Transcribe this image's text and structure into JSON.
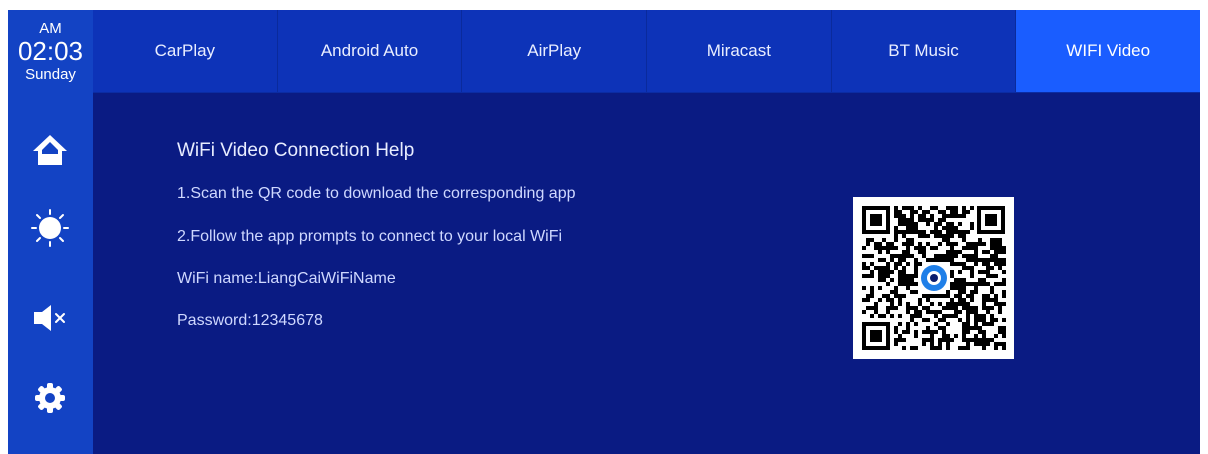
{
  "clock": {
    "ampm": "AM",
    "time": "02:03",
    "day": "Sunday"
  },
  "sidebar": {
    "buttons": [
      {
        "name": "home-icon"
      },
      {
        "name": "brightness-icon"
      },
      {
        "name": "mute-icon"
      },
      {
        "name": "settings-icon"
      }
    ]
  },
  "tabs": [
    {
      "label": "CarPlay",
      "active": false
    },
    {
      "label": "Android Auto",
      "active": false
    },
    {
      "label": "AirPlay",
      "active": false
    },
    {
      "label": "Miracast",
      "active": false
    },
    {
      "label": "BT Music",
      "active": false
    },
    {
      "label": "WIFI Video",
      "active": true
    }
  ],
  "help": {
    "title": "WiFi Video Connection Help",
    "step1": "1.Scan the QR code to download the corresponding app",
    "step2": "2.Follow the app prompts to connect to your local WiFi",
    "wifi_name": "WiFi name:LiangCaiWiFiName",
    "password": "Password:12345678"
  },
  "qr": {
    "icon": "qr-code-icon"
  },
  "colors": {
    "background": "#0a1b83",
    "sidebar": "#1343c4",
    "tab_bar": "#0d33b8",
    "tab_active": "#1a5dff"
  }
}
